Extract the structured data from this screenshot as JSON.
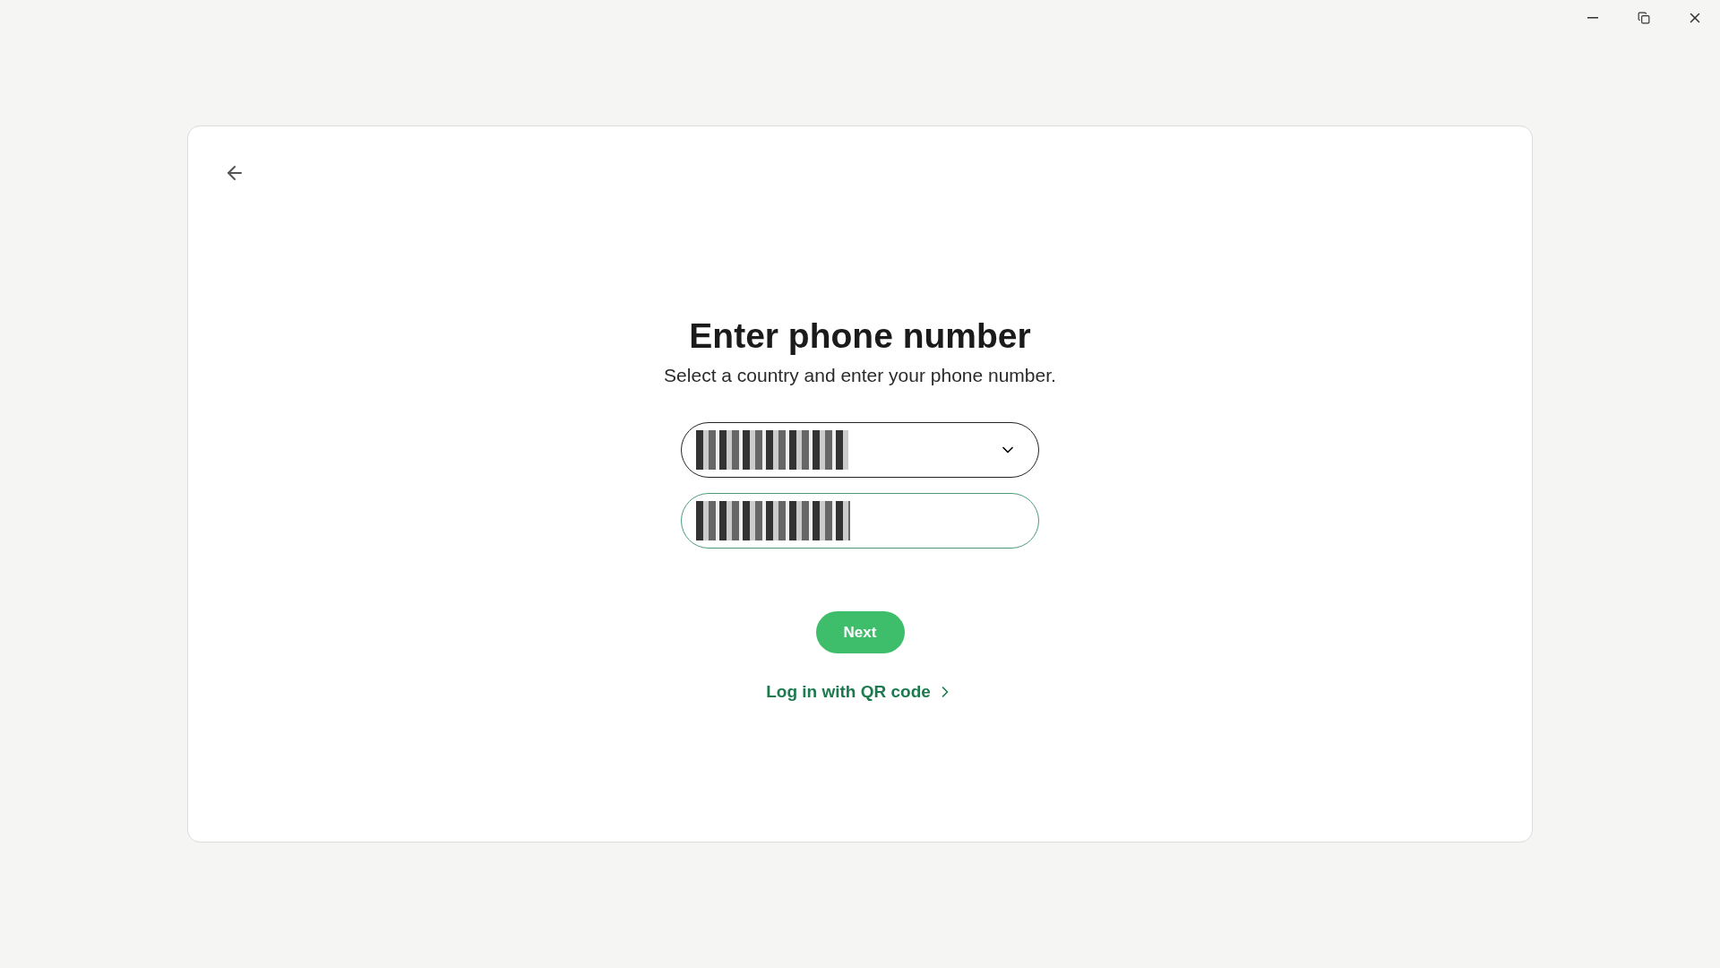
{
  "heading": {
    "title": "Enter phone number",
    "subtitle": "Select a country and enter your phone number."
  },
  "fields": [
    {
      "kind": "select"
    },
    {
      "kind": "input"
    }
  ],
  "next_button": {
    "label": "Next"
  },
  "qr_link": {
    "label": "Log in with QR code"
  }
}
